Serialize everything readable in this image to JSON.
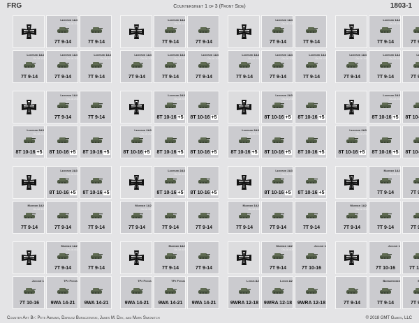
{
  "header": {
    "left": "FRG",
    "center": "Countersheet 1 of 3 (Front Side)",
    "right": "1803-1"
  },
  "footer": {
    "left": "Counter Art By: Pete Abrams, Dariusz Buraczewski, James M. Day, and Mark Simonitch",
    "right": "© 2018 GMT Games, LLC"
  },
  "blocks": [
    {
      "top": [
        {
          "k": "cross"
        },
        {
          "n": "Leopard 1A4",
          "g": "Gs-1A 1/1",
          "s": "7T 9-14"
        },
        {
          "n": "",
          "g": "",
          "s": "7T 9-14"
        }
      ],
      "bot": [
        {
          "n": "Leopard 1A4",
          "g": "Gs-1A 1/1",
          "s": "7T 9-14"
        },
        {
          "n": "Leopard 1A4",
          "g": "Gs-1A 1/1",
          "s": "7T 9-14"
        },
        {
          "n": "Leopard 1A4",
          "g": "Gs-1A 1/1",
          "s": "7T 9-14"
        }
      ]
    },
    {
      "top": [
        {
          "k": "cross"
        },
        {
          "n": "Leopard 1A4",
          "g": "Gs-1A 1/2",
          "s": "7T 9-14"
        },
        {
          "n": "",
          "g": "",
          "s": "7T 9-14"
        }
      ],
      "bot": [
        {
          "n": "Leopard 1A4",
          "g": "Gs-1A 1/2",
          "s": "7T 9-14"
        },
        {
          "n": "Leopard 1A4",
          "g": "Gs-1A 1/2",
          "s": "7T 9-14"
        },
        {
          "n": "Leopard 1A4",
          "g": "Gs-1A 1/2",
          "s": "7T 9-14"
        }
      ]
    },
    {
      "top": [
        {
          "k": "cross"
        },
        {
          "n": "Leopard 1A4",
          "g": "Gs-1A 1/3",
          "s": "7T 9-14"
        },
        {
          "n": "",
          "g": "",
          "s": "7T 9-14"
        }
      ],
      "bot": [
        {
          "n": "Leopard 1A4",
          "g": "Gs-1A 1/3",
          "s": "7T 9-14"
        },
        {
          "n": "Leopard 1A4",
          "g": "Gs-1A 1/3",
          "s": "7T 9-14"
        },
        {
          "n": "Leopard 1A4",
          "g": "Gs-1A 1/3",
          "s": "7T 9-14"
        }
      ]
    },
    {
      "top": [
        {
          "k": "cross"
        },
        {
          "n": "Leopard 1A4",
          "g": "Gs-1A 1/4",
          "s": "7T 9-14"
        },
        {
          "n": "",
          "g": "",
          "s": "7T 9-14"
        }
      ],
      "bot": [
        {
          "n": "Leopard 1A4",
          "g": "Gs-1A 1/4",
          "s": "7T 9-14"
        },
        {
          "n": "Leopard 1A4",
          "g": "Gs-1A 1/4",
          "s": "7T 9-14"
        },
        {
          "n": "Leopard 1A4",
          "g": "Gs-1A 1/4",
          "s": "7T 9-14"
        }
      ]
    },
    {
      "top": [
        {
          "k": "cross"
        },
        {
          "n": "Leopard 1A4",
          "g": "Gs-1A 2/1",
          "s": "7T 9-14"
        },
        {
          "n": "",
          "g": "",
          "s": "7T 9-14"
        }
      ],
      "bot": [
        {
          "n": "Leopard 2A3",
          "g": "Gs-1A 2/1",
          "s": "8T 10-16",
          "p": "+5"
        },
        {
          "n": "",
          "g": "",
          "s": "8T 10-16",
          "p": "+5"
        },
        {
          "n": "",
          "g": "",
          "s": "8T 10-16",
          "p": "+5"
        }
      ]
    },
    {
      "top": [
        {
          "k": "cross"
        },
        {
          "n": "Leopard 2A3",
          "g": "Gs-1A 2/2",
          "s": "8T 10-16",
          "p": "+5"
        },
        {
          "n": "",
          "g": "",
          "s": "8T 10-16",
          "p": "+5"
        }
      ],
      "bot": [
        {
          "n": "Leopard 2A3",
          "g": "Gs-1A 2/2",
          "s": "8T 10-16",
          "p": "+5"
        },
        {
          "n": "",
          "g": "",
          "s": "8T 10-16",
          "p": "+5"
        },
        {
          "n": "",
          "g": "",
          "s": "8T 10-16",
          "p": "+5"
        }
      ]
    },
    {
      "top": [
        {
          "k": "cross"
        },
        {
          "n": "Leopard 2A3",
          "g": "Gs-1A 2/3",
          "s": "8T 10-16",
          "p": "+5"
        },
        {
          "n": "",
          "g": "",
          "s": "8T 10-16",
          "p": "+5"
        }
      ],
      "bot": [
        {
          "n": "Leopard 2A3",
          "g": "Gs-1A 2/3",
          "s": "8T 10-16",
          "p": "+5"
        },
        {
          "n": "",
          "g": "",
          "s": "8T 10-16",
          "p": "+5"
        },
        {
          "n": "",
          "g": "",
          "s": "8T 10-16",
          "p": "+5"
        }
      ]
    },
    {
      "top": [
        {
          "k": "cross"
        },
        {
          "n": "Leopard 2A3",
          "g": "Gs-1A 2/4",
          "s": "8T 10-16",
          "p": "+5"
        },
        {
          "n": "",
          "g": "",
          "s": "8T 10-16",
          "p": "+5"
        }
      ],
      "bot": [
        {
          "n": "Leopard 2A3",
          "g": "Gs-1A 2/4",
          "s": "8T 10-16",
          "p": "+5"
        },
        {
          "n": "",
          "g": "",
          "s": "8T 10-16",
          "p": "+5"
        },
        {
          "n": "",
          "g": "",
          "s": "8T 10-16",
          "p": "+5"
        }
      ]
    },
    {
      "top": [
        {
          "k": "cross"
        },
        {
          "n": "Leopard 2A3",
          "g": "Gs-1A 3/1",
          "s": "8T 10-16",
          "p": "+5"
        },
        {
          "n": "",
          "g": "",
          "s": "8T 10-16",
          "p": "+5"
        }
      ],
      "bot": [
        {
          "n": "Marder 1A2",
          "g": "Gs-1A 3/1",
          "s": "7T 9-14"
        },
        {
          "n": "",
          "g": "",
          "s": "7T 9-14"
        },
        {
          "n": "",
          "g": "",
          "s": "7T 9-14"
        }
      ]
    },
    {
      "top": [
        {
          "k": "cross"
        },
        {
          "n": "Leopard 2A3",
          "g": "Gs-1A 3/2",
          "s": "8T 10-16",
          "p": "+5"
        },
        {
          "n": "",
          "g": "",
          "s": "8T 10-16",
          "p": "+5"
        }
      ],
      "bot": [
        {
          "n": "Marder 1A2",
          "g": "Gs-1A 3/2",
          "s": "7T 9-14"
        },
        {
          "n": "",
          "g": "",
          "s": "7T 9-14"
        },
        {
          "n": "",
          "g": "",
          "s": "7T 9-14"
        }
      ]
    },
    {
      "top": [
        {
          "k": "cross"
        },
        {
          "n": "Leopard 2A3",
          "g": "Gs-1A 3/3",
          "s": "8T 10-16",
          "p": "+5"
        },
        {
          "n": "",
          "g": "",
          "s": "8T 10-16",
          "p": "+5"
        }
      ],
      "bot": [
        {
          "n": "Marder 1A2",
          "g": "Gs-1A 3/3",
          "s": "7T 9-14"
        },
        {
          "n": "",
          "g": "",
          "s": "7T 9-14"
        },
        {
          "n": "",
          "g": "",
          "s": "7T 9-14"
        }
      ]
    },
    {
      "top": [
        {
          "k": "cross"
        },
        {
          "n": "Marder 1A2",
          "g": "Gs-1A 3/4",
          "s": "7T 9-14"
        },
        {
          "n": "",
          "g": "",
          "s": "7T 9-14"
        }
      ],
      "bot": [
        {
          "n": "Marder 1A2",
          "g": "Gs-1A 3/4",
          "s": "7T 9-14"
        },
        {
          "n": "",
          "g": "",
          "s": "7T 9-14"
        },
        {
          "n": "",
          "g": "",
          "s": "7T 9-14"
        }
      ]
    },
    {
      "top": [
        {
          "k": "cross"
        },
        {
          "n": "Marder 1A2",
          "g": "Gs-1A 4/1",
          "s": "7T 9-14"
        },
        {
          "n": "",
          "g": "",
          "s": "7T 9-14"
        }
      ],
      "bot": [
        {
          "n": "Jaguar 1",
          "g": "",
          "s": "7T 10-16"
        },
        {
          "n": "TPz Fuchs",
          "g": "",
          "s": "9WA 14-21"
        },
        {
          "n": "",
          "g": "",
          "s": "9WA 14-21"
        }
      ]
    },
    {
      "top": [
        {
          "k": "cross"
        },
        {
          "n": "Marder 1A2",
          "g": "Gs-1A 4/2",
          "s": "7T 9-14"
        },
        {
          "n": "",
          "g": "",
          "s": "7T 9-14"
        }
      ],
      "bot": [
        {
          "n": "TPz Fuchs",
          "g": "",
          "s": "9WA 14-21"
        },
        {
          "n": "TPz Fuchs",
          "g": "",
          "s": "9WA 14-21"
        },
        {
          "n": "",
          "g": "",
          "s": "9WA 14-21"
        }
      ]
    },
    {
      "top": [
        {
          "k": "cross"
        },
        {
          "n": "Marder 1A2",
          "g": "Gs-1A 4/3",
          "s": "7T 9-14"
        },
        {
          "n": "Jaguar 1",
          "g": "",
          "s": "7T 10-16"
        }
      ],
      "bot": [
        {
          "n": "Luchs A2",
          "g": "",
          "s": "9WRA 12-18"
        },
        {
          "n": "Luchs A2",
          "g": "",
          "s": "9WRA 12-18"
        },
        {
          "n": "",
          "g": "",
          "s": "9WRA 12-18"
        }
      ]
    },
    {
      "top": [
        {
          "k": "cross"
        },
        {
          "n": "Jaguar 1",
          "g": "",
          "s": "7T 10-16"
        },
        {
          "n": "Jaguar 1",
          "g": "",
          "s": "7T 10-16"
        }
      ],
      "bot": [
        {
          "n": "",
          "g": "",
          "s": "7T 9-14"
        },
        {
          "n": "Bergepanzer",
          "g": "",
          "s": "7T 9-14"
        },
        {
          "n": "Biber AVLB",
          "g": "",
          "s": "7T 9-14"
        }
      ]
    }
  ]
}
